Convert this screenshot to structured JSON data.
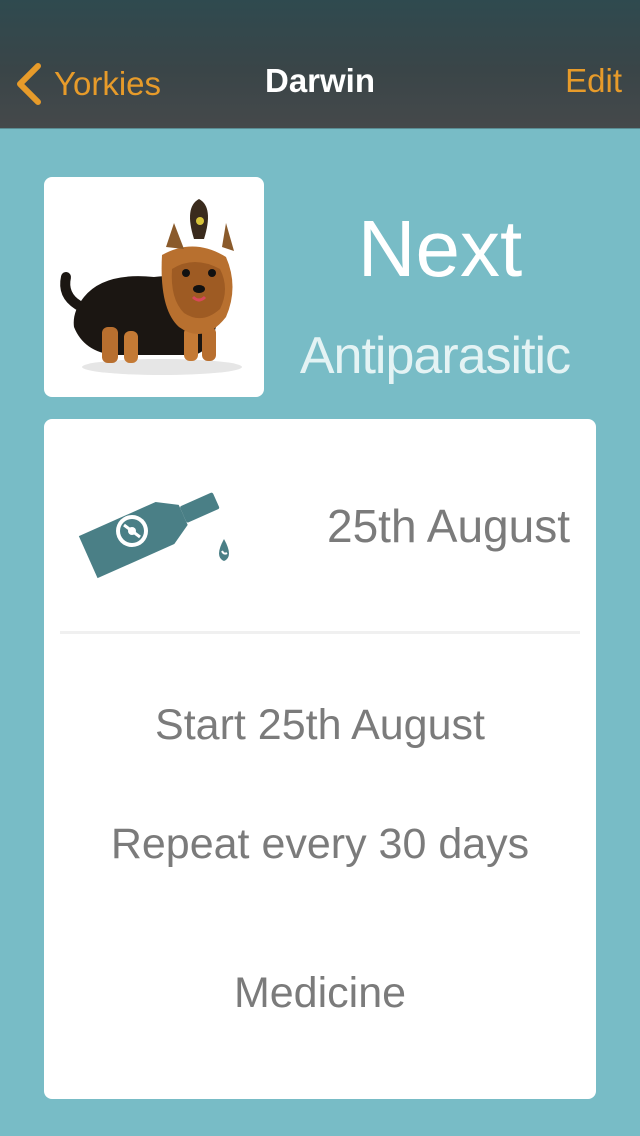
{
  "navbar": {
    "back_label": "Yorkies",
    "title": "Darwin",
    "edit_label": "Edit"
  },
  "header": {
    "next_label": "Next",
    "type_label": "Antiparasitic"
  },
  "card": {
    "next_date": "25th August",
    "start": "Start 25th August",
    "repeat": "Repeat every 30 days",
    "category": "Medicine",
    "icon": "antiparasitic-bottle-icon"
  },
  "colors": {
    "background": "#78bcc6",
    "accent": "#e79b2a",
    "icon": "#4a7f86",
    "text": "#7b7b7b"
  }
}
